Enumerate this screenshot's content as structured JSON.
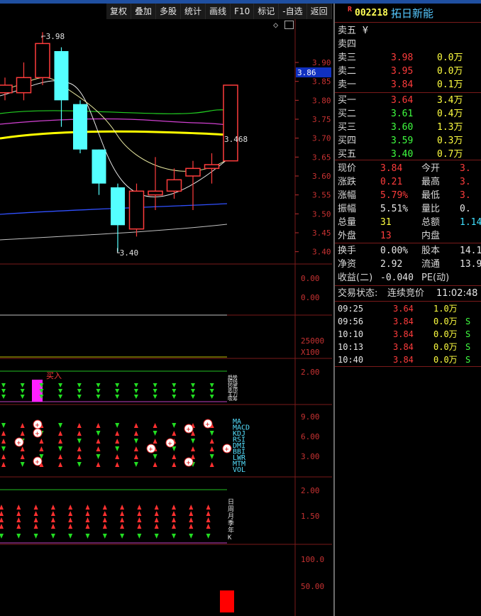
{
  "toolbar": [
    "复权",
    "叠加",
    "多股",
    "统计",
    "画线",
    "F10",
    "标记",
    "-自选",
    "返回"
  ],
  "stock": {
    "badge": "R",
    "code": "002218",
    "name": "拓日新能"
  },
  "main_chart": {
    "price_ticks": [
      "3.90",
      "3.85",
      "3.80",
      "3.75",
      "3.70",
      "3.65",
      "3.60",
      "3.55",
      "3.50",
      "3.45",
      "3.40"
    ],
    "current_price_tag": "3.86",
    "high_label": "3.98",
    "low_label": "3.40",
    "last_label": "3.468",
    "candles": [
      {
        "o": 3.82,
        "c": 3.84,
        "h": 3.86,
        "l": 3.8,
        "color": "red"
      },
      {
        "o": 3.82,
        "c": 3.86,
        "h": 3.9,
        "l": 3.8,
        "color": "red"
      },
      {
        "o": 3.86,
        "c": 3.95,
        "h": 3.98,
        "l": 3.84,
        "color": "red"
      },
      {
        "o": 3.93,
        "c": 3.8,
        "h": 3.94,
        "l": 3.73,
        "color": "cyan"
      },
      {
        "o": 3.79,
        "c": 3.67,
        "h": 3.8,
        "l": 3.66,
        "color": "cyan"
      },
      {
        "o": 3.67,
        "c": 3.58,
        "h": 3.67,
        "l": 3.55,
        "color": "cyan"
      },
      {
        "o": 3.57,
        "c": 3.47,
        "h": 3.58,
        "l": 3.4,
        "color": "cyan"
      },
      {
        "o": 3.46,
        "c": 3.56,
        "h": 3.58,
        "l": 3.44,
        "color": "red"
      },
      {
        "o": 3.55,
        "c": 3.56,
        "h": 3.65,
        "l": 3.51,
        "color": "red"
      },
      {
        "o": 3.56,
        "c": 3.59,
        "h": 3.62,
        "l": 3.54,
        "color": "red"
      },
      {
        "o": 3.6,
        "c": 3.62,
        "h": 3.64,
        "l": 3.51,
        "color": "red"
      },
      {
        "o": 3.62,
        "c": 3.63,
        "h": 3.66,
        "l": 3.58,
        "color": "red"
      },
      {
        "o": 3.64,
        "c": 3.84,
        "h": 3.84,
        "l": 3.64,
        "color": "red"
      }
    ]
  },
  "sub_panels": {
    "panel1_ticks": [
      "0.00",
      "0.00"
    ],
    "panel2_ticks": [
      "25000",
      "X100"
    ],
    "panel3_ticks": [
      "2.00"
    ],
    "panel3_label": "买入",
    "panel3_side": [
      "趋势",
      "短线",
      "抄底",
      "逃顶",
      "主力",
      "吸筹"
    ],
    "panel4_ticks": [
      "9.00",
      "6.00",
      "3.00"
    ],
    "panel4_side": [
      "MA",
      "MACD",
      "KDJ",
      "RSI",
      "DMI",
      "BBI",
      "LWR",
      "MTM",
      "VOL"
    ],
    "panel5_ticks": [
      "2.00",
      "1.50"
    ],
    "panel5_side": [
      "日",
      "周",
      "月",
      "季",
      "年",
      "K"
    ],
    "panel6_ticks": [
      "100.0",
      "50.00"
    ]
  },
  "quote": {
    "asks": [
      {
        "label": "卖五",
        "price": "",
        "vol": "",
        "extra": "¥"
      },
      {
        "label": "卖四",
        "price": "",
        "vol": ""
      },
      {
        "label": "卖三",
        "price": "3.98",
        "vol": "0.0万"
      },
      {
        "label": "卖二",
        "price": "3.95",
        "vol": "0.0万"
      },
      {
        "label": "卖一",
        "price": "3.84",
        "vol": "0.1万"
      }
    ],
    "bids": [
      {
        "label": "买一",
        "price": "3.64",
        "vol": "3.4万",
        "color": "red"
      },
      {
        "label": "买二",
        "price": "3.61",
        "vol": "0.4万",
        "color": "green"
      },
      {
        "label": "买三",
        "price": "3.60",
        "vol": "1.3万",
        "color": "green"
      },
      {
        "label": "买四",
        "price": "3.59",
        "vol": "0.3万",
        "color": "green"
      },
      {
        "label": "买五",
        "price": "3.40",
        "vol": "0.7万",
        "color": "green"
      }
    ],
    "stats": [
      {
        "l1": "现价",
        "v1": "3.84",
        "c1": "red",
        "l2": "今开",
        "v2": "3.",
        "c2": "red"
      },
      {
        "l1": "涨跌",
        "v1": "0.21",
        "c1": "red",
        "l2": "最高",
        "v2": "3.",
        "c2": "red"
      },
      {
        "l1": "涨幅",
        "v1": "5.79%",
        "c1": "red",
        "l2": "最低",
        "v2": "3.",
        "c2": "red"
      },
      {
        "l1": "振幅",
        "v1": "5.51%",
        "c1": "white",
        "l2": "量比",
        "v2": "0.",
        "c2": "white"
      },
      {
        "l1": "总量",
        "v1": "31",
        "c1": "yel",
        "l2": "总额",
        "v2": "1.14",
        "c2": "cyan"
      },
      {
        "l1": "外盘",
        "v1": "13",
        "c1": "red",
        "l2": "内盘",
        "v2": "",
        "c2": "green"
      }
    ],
    "fin": [
      {
        "l1": "换手",
        "v1": "0.00%",
        "l2": "股本",
        "v2": "14.1"
      },
      {
        "l1": "净资",
        "v1": "2.92",
        "l2": "流通",
        "v2": "13.9"
      },
      {
        "l1": "收益(二)",
        "v1": "-0.040",
        "l2": "PE(动)",
        "v2": ""
      }
    ],
    "status_label": "交易状态:",
    "status_value": "连续竞价",
    "status_time": "11:02:48"
  },
  "ticks": [
    {
      "time": "09:25",
      "price": "3.64",
      "vol": "1.0万",
      "flag": ""
    },
    {
      "time": "09:56",
      "price": "3.84",
      "vol": "0.0万",
      "flag": "S"
    },
    {
      "time": "10:10",
      "price": "3.84",
      "vol": "0.0万",
      "flag": "S"
    },
    {
      "time": "10:13",
      "price": "3.84",
      "vol": "0.0万",
      "flag": "S"
    },
    {
      "time": "10:40",
      "price": "3.84",
      "vol": "0.0万",
      "flag": "S"
    }
  ],
  "colors": {
    "up": "#ff3c3c",
    "down": "#54ffff",
    "ma_yellow": "#ffff00",
    "grid": "#7a1a1a"
  }
}
